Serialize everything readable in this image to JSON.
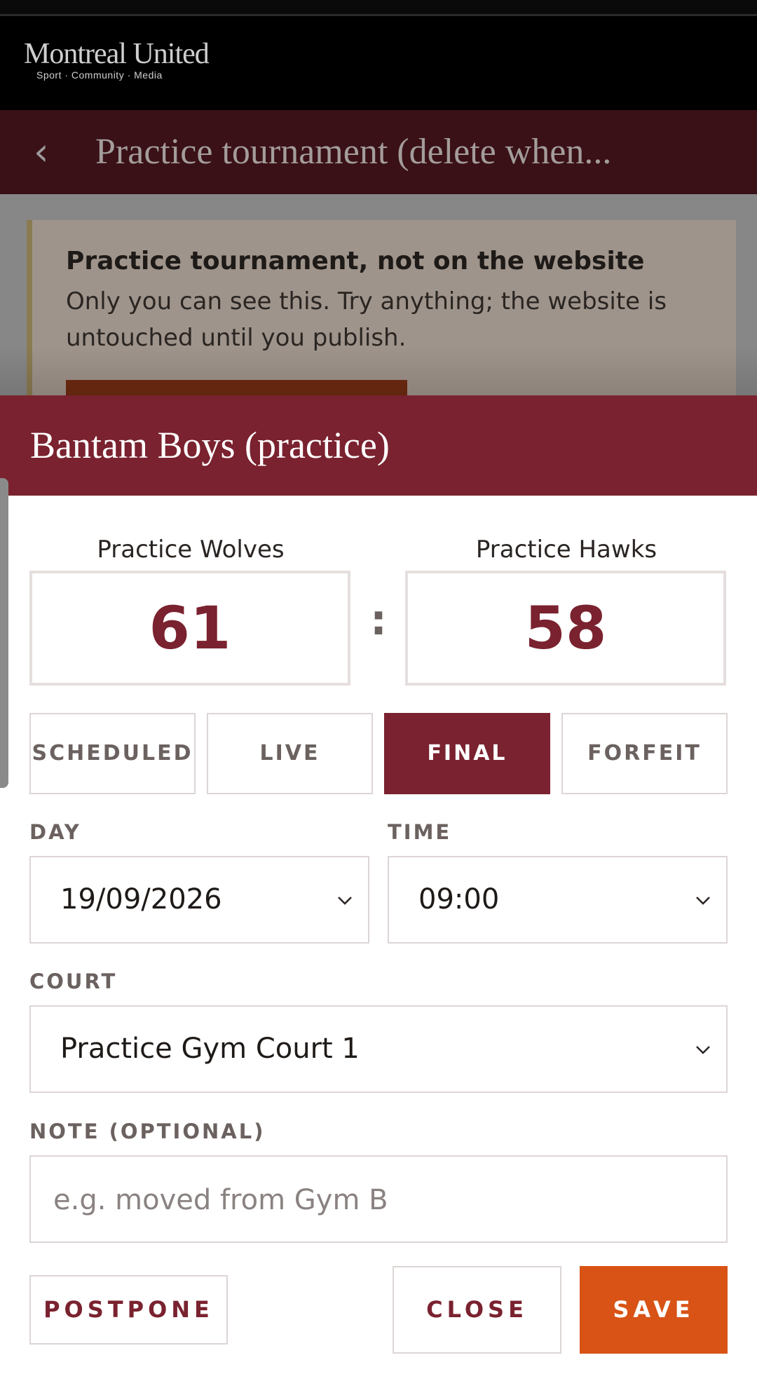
{
  "header": {
    "brand_name": "Montreal United",
    "brand_tagline": "Sport · Community · Media",
    "title": "Practice tournament (delete when..."
  },
  "notice": {
    "title": "Practice tournament, not on the website",
    "body": "Only you can see this. Try anything; the website is untouched until you publish."
  },
  "sheet": {
    "title": "Bantam Boys (practice)",
    "home_team": "Practice Wolves",
    "away_team": "Practice Hawks",
    "home_score": "61",
    "away_score": "58",
    "separator": ":",
    "statuses": [
      "SCHEDULED",
      "LIVE",
      "FINAL",
      "FORFEIT"
    ],
    "selected_status": "FINAL",
    "day_label": "DAY",
    "day_value": "19/09/2026",
    "time_label": "TIME",
    "time_value": "09:00",
    "court_label": "COURT",
    "court_value": "Practice Gym Court 1",
    "note_label": "NOTE (OPTIONAL)",
    "note_placeholder": "e.g. moved from Gym B",
    "note_value": ""
  },
  "actions": {
    "postpone": "POSTPONE",
    "close": "CLOSE",
    "save": "SAVE"
  },
  "colors": {
    "brand": "#7a222f",
    "accent": "#d85315",
    "header_bg": "#000000"
  }
}
